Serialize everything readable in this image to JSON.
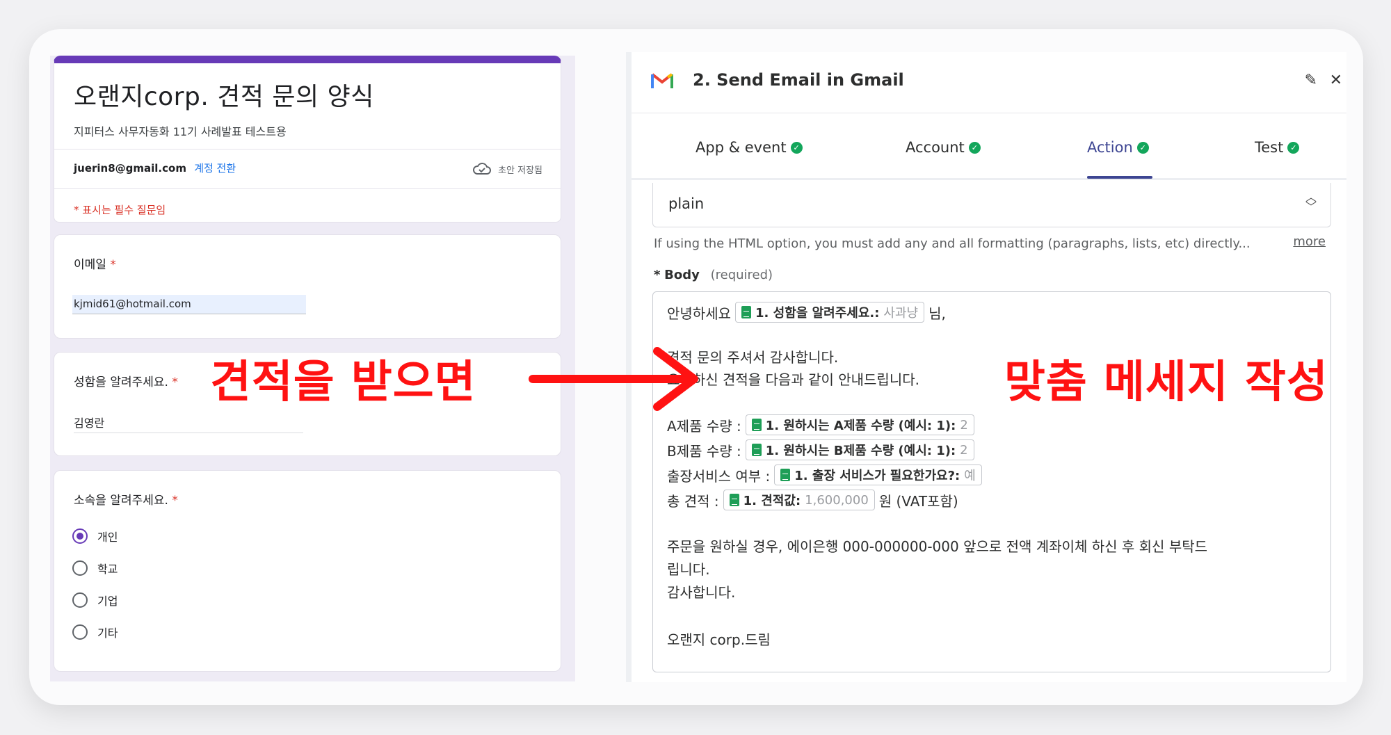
{
  "form": {
    "title": "오랜지corp. 견적 문의 양식",
    "subtitle": "지피터스 사무자동화 11기 사례발표 테스트용",
    "account_email": "juerin8@gmail.com",
    "switch_account": "계정 전환",
    "draft_status": "초안 저장됨",
    "required_note": "* 표시는 필수 질문임",
    "questions": {
      "email": {
        "label": "이메일",
        "star": "*",
        "value": "kjmid61@hotmail.com"
      },
      "name": {
        "label": "성함을 알려주세요.",
        "star": "*",
        "value": "김영란"
      },
      "affiliation": {
        "label": "소속을 알려주세요.",
        "star": "*",
        "options": [
          "개인",
          "학교",
          "기업",
          "기타"
        ],
        "selected": "개인"
      }
    }
  },
  "annotations": {
    "left": "견적을 받으면",
    "right": "맞춤 메세지 작성",
    "color": "#ff1212"
  },
  "zap": {
    "step_title": "2. Send Email in Gmail",
    "tabs": [
      {
        "label": "App & event"
      },
      {
        "label": "Account"
      },
      {
        "label": "Action"
      },
      {
        "label": "Test"
      }
    ],
    "active_tab": "Action",
    "body_type_value": "plain",
    "hint": "If using the HTML option, you must add any and all formatting (paragraphs, lists, etc) directly...",
    "more": "more",
    "body_label_star": "*",
    "body_label": "Body",
    "body_required": "(required)",
    "body": {
      "greeting_prefix": "안녕하세요",
      "greeting_pill": {
        "label": "1. 성함을 알려주세요.:",
        "value": "사과냥"
      },
      "greeting_suffix": "님,",
      "thanks": "견적 문의 주셔서 감사합니다.",
      "intro": "요청하신 견적을 다음과 같이 안내드립니다.",
      "rows": [
        {
          "prefix": "A제품 수량 :",
          "pill_label": "1. 원하시는 A제품 수량 (예시: 1):",
          "pill_value": "2",
          "suffix": ""
        },
        {
          "prefix": "B제품 수량 :",
          "pill_label": "1. 원하시는 B제품 수량 (예시: 1):",
          "pill_value": "2",
          "suffix": ""
        },
        {
          "prefix": "출장서비스 여부 :",
          "pill_label": "1. 출장 서비스가 필요한가요?:",
          "pill_value": "예",
          "suffix": ""
        },
        {
          "prefix": "총 견적 :",
          "pill_label": "1. 견적값:",
          "pill_value": "1,600,000",
          "suffix": "원 (VAT포함)"
        }
      ],
      "order_line1": "주문을 원하실 경우, 에이은행 000-000000-000 앞으로 전액 계좌이체 하신 후 회신 부탁드",
      "order_line2": "립니다.",
      "closing": "감사합니다.",
      "signature": "오랜지 corp.드림"
    }
  },
  "colors": {
    "form_accent": "#673ab7",
    "required": "#d93025",
    "zap_active": "#3d4592",
    "check": "#13a65b"
  }
}
